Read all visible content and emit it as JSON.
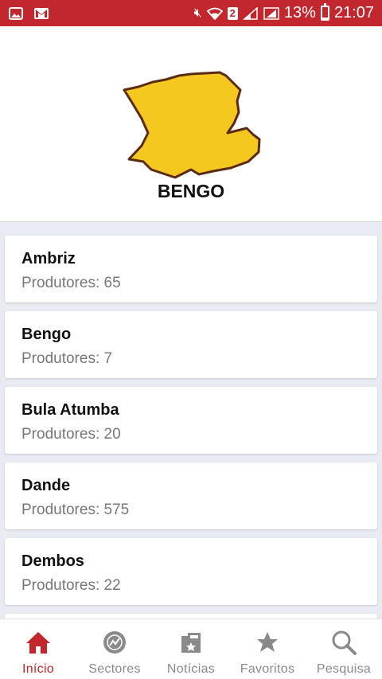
{
  "status_bar": {
    "sim_badge": "2",
    "battery": "13%",
    "time": "21:07"
  },
  "province": {
    "title": "BENGO",
    "map_fill": "#f4c81e",
    "map_stroke": "#5a2a12"
  },
  "municipalities": [
    {
      "name": "Ambriz",
      "producers": "Produtores: 65"
    },
    {
      "name": "Bengo",
      "producers": "Produtores: 7"
    },
    {
      "name": "Bula Atumba",
      "producers": "Produtores: 20"
    },
    {
      "name": "Dande",
      "producers": "Produtores: 575"
    },
    {
      "name": "Dembos",
      "producers": "Produtores: 22"
    }
  ],
  "bottom_nav": [
    {
      "label": "Início",
      "icon": "home-icon",
      "active": true
    },
    {
      "label": "Sectores",
      "icon": "sectors-icon",
      "active": false
    },
    {
      "label": "Notícias",
      "icon": "news-icon",
      "active": false
    },
    {
      "label": "Favoritos",
      "icon": "star-icon",
      "active": false
    },
    {
      "label": "Pesquisa",
      "icon": "search-icon",
      "active": false
    }
  ],
  "colors": {
    "accent": "#c1272d",
    "inactive": "#8a8a8a"
  }
}
